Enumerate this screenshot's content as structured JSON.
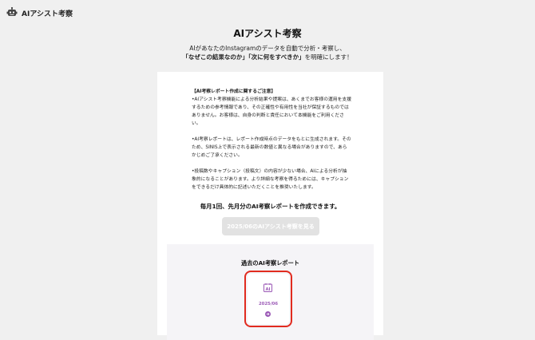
{
  "app": {
    "title": "AIアシスト考察"
  },
  "header": {
    "title": "AIアシスト考察",
    "subtitle_line1": "AIがあなたのInstagramのデータを自動で分析・考察し、",
    "subtitle_line2_emphasis": "「なぜこの結果なのか」「次に何をすべきか」",
    "subtitle_line2_rest": "を明確にします！"
  },
  "notice": {
    "heading": "【AI考察レポート作成に関するご注意】",
    "paragraph1": "•AIアシスト考察機能による分析結果や提案は、あくまでお客様の運用を支援するための参考情報であり、その正確性や有用性を当社が保証するものではありません。お客様は、自身の判断と責任において本機能をご利用ください。",
    "paragraph2": "•AI考察レポートは、レポート作成時点のデータをもとに生成されます。そのため、SINIS上で表示される最新の数値と異なる場合がありますので、あらかじめご了承ください。",
    "paragraph3": "•投稿数やキャプション（投稿文）の内容が少ない場合、AIによる分析が抽象的になることがあります。より詳細な考察を得るためには、キャプションをできるだけ具体的に記述いただくことを推奨いたします。"
  },
  "monthly_text": "毎月1回、先月分のAI考察レポートを作成できます。",
  "view_button": {
    "label": "2025/06のAIアシスト考察を見る",
    "disabled": true
  },
  "past_reports": {
    "title": "過去のAI考察レポート",
    "items": [
      {
        "date": "2025/06",
        "icon": "ai-report-icon"
      }
    ]
  },
  "colors": {
    "accent": "#9b59b6",
    "highlight": "#e12b1f",
    "button_disabled": "#e2e2e2",
    "background": "#f0f0f0"
  }
}
